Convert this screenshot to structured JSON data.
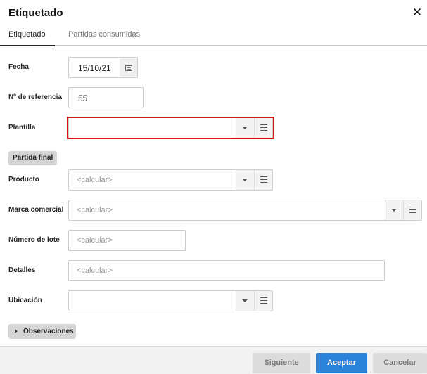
{
  "dialog": {
    "title": "Etiquetado",
    "close_icon": "close-icon"
  },
  "tabs": [
    {
      "label": "Etiquetado",
      "active": true
    },
    {
      "label": "Partidas consumidas",
      "active": false
    }
  ],
  "form": {
    "fecha": {
      "label": "Fecha",
      "value": "15/10/21",
      "icon": "calendar-icon"
    },
    "referencia": {
      "label": "Nº de referencia",
      "value": "55"
    },
    "plantilla": {
      "label": "Plantilla",
      "value": "",
      "highlight_color": "#d9141c"
    },
    "section_title": "Partida final",
    "producto": {
      "label": "Producto",
      "placeholder": "<calcular>"
    },
    "marca": {
      "label": "Marca comercial",
      "placeholder": "<calcular>"
    },
    "lote": {
      "label": "Número de lote",
      "placeholder": "<calcular>"
    },
    "detalles": {
      "label": "Detalles",
      "placeholder": "<calcular>"
    },
    "ubicacion": {
      "label": "Ubicación",
      "value": ""
    },
    "observaciones": {
      "label": "Observaciones"
    }
  },
  "footer": {
    "next_label": "Siguiente",
    "ok_label": "Aceptar",
    "cancel_label": "Cancelar"
  },
  "colors": {
    "accent": "#2b82d9",
    "highlight": "#d9141c"
  }
}
